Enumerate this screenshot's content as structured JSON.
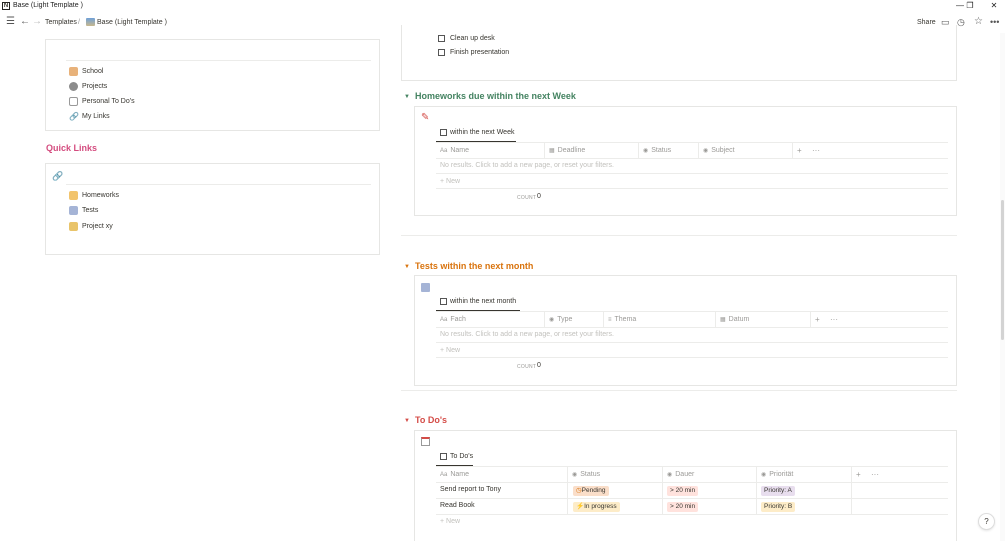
{
  "window": {
    "title": "Base (Light Template )",
    "app_icon": "N"
  },
  "topbar": {
    "breadcrumb_1": "Templates",
    "breadcrumb_sep": "/",
    "breadcrumb_2": "Base (Light Template )",
    "share_label": "Share"
  },
  "left": {
    "nav_links": [
      "School",
      "Projects",
      "Personal To Do's",
      "My Links"
    ],
    "quick_links_heading": "Quick Links",
    "quick_links": [
      "Homeworks",
      "Tests",
      "Project xy"
    ]
  },
  "todo_checklist": [
    "Clean up desk",
    "Finish presentation"
  ],
  "homeworks": {
    "heading": "Homeworks due within the next Week",
    "view_tab": "within the next Week",
    "columns": [
      "Name",
      "Deadline",
      "Status",
      "Subject"
    ],
    "empty_text": "No results. Click to add a new page, or reset your filters.",
    "new_label": "New",
    "count_label": "COUNT",
    "count_value": "0"
  },
  "tests": {
    "heading": "Tests within the next month",
    "view_tab": "within the next month",
    "columns": [
      "Fach",
      "Type",
      "Thema",
      "Datum"
    ],
    "empty_text": "No results. Click to add a new page, or reset your filters.",
    "new_label": "New",
    "count_label": "COUNT",
    "count_value": "0"
  },
  "todos": {
    "heading": "To Do's",
    "view_tab": "To Do's",
    "columns": [
      "Name",
      "Status",
      "Dauer",
      "Priorität"
    ],
    "rows": [
      {
        "name": "Send report to Tony",
        "status": "Pending",
        "dauer": "> 20 min",
        "priority": "Priority: A"
      },
      {
        "name": "Read Book",
        "status": "In progress",
        "dauer": "> 20 min",
        "priority": "Priority: B"
      }
    ],
    "new_label": "New"
  },
  "colors": {
    "quick_links_heading": "#d44c7f",
    "homeworks_heading": "#448361",
    "tests_heading": "#d9730d",
    "todos_heading": "#d44c47",
    "tag_pending_bg": "#fadec9",
    "tag_progress_bg": "#fdecc8",
    "tag_dauer_bg": "#ffe2dd",
    "tag_priority_bg": "#e8deee"
  },
  "help_label": "?"
}
